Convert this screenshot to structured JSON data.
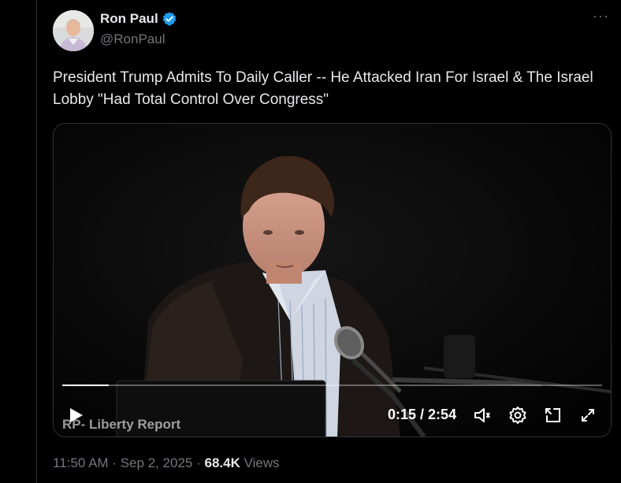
{
  "author": {
    "display_name": "Ron Paul",
    "handle": "@RonPaul",
    "verified": true,
    "verified_color": "#1d9bf0"
  },
  "menu": {
    "more_label": "···"
  },
  "tweet": {
    "text": "President Trump Admits To Daily Caller -- He Attacked Iran For Israel & The Israel Lobby \"Had Total Control Over Congress\""
  },
  "video": {
    "channel_label": "RP- Liberty Report",
    "current_time": "0:15",
    "separator": " / ",
    "duration": "2:54",
    "progress_fraction": 0.086,
    "controls": [
      "play-icon",
      "volume-icon",
      "settings-icon",
      "dock-icon",
      "fullscreen-icon"
    ]
  },
  "meta": {
    "time": "11:50 AM",
    "dot1": " · ",
    "date": "Sep 2, 2025",
    "dot2": " · ",
    "views_count": "68.4K",
    "views_label": " Views"
  },
  "colors": {
    "background": "#000000",
    "text": "#e7e9ea",
    "secondary": "#71767b",
    "border": "#2f3336"
  }
}
